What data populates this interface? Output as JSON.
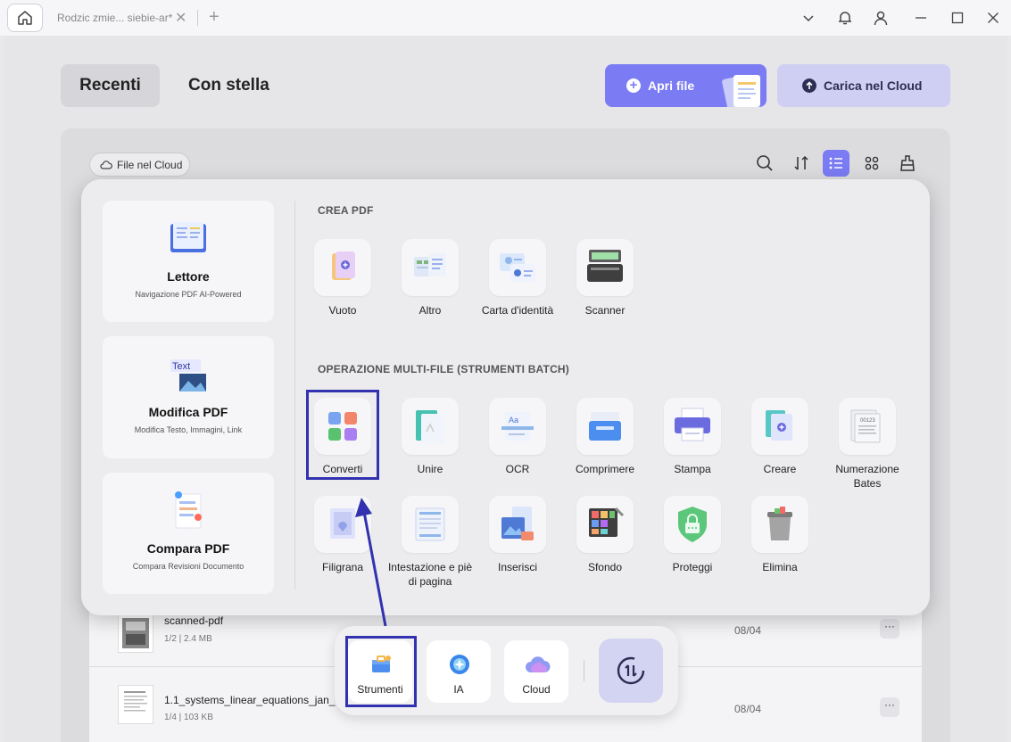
{
  "titlebar": {
    "tab_title": "Rodzic zmie... siebie-ar*",
    "tab_close": "✕",
    "tab_new": "+"
  },
  "nav": {
    "recenti": "Recenti",
    "con_stella": "Con stella"
  },
  "actions": {
    "apri_file": "Apri file",
    "carica_cloud": "Carica nel Cloud"
  },
  "toolbar": {
    "cloud_chip": "File nel Cloud"
  },
  "sidebar": {
    "cards": [
      {
        "title": "Lettore",
        "subtitle": "Navigazione PDF AI-Powered"
      },
      {
        "title": "Modifica PDF",
        "subtitle": "Modifica Testo, Immagini, Link",
        "icon_text": "Text"
      },
      {
        "title": "Compara PDF",
        "subtitle": "Compara Revisioni Documento"
      }
    ]
  },
  "crea_pdf": {
    "title": "CREA PDF",
    "tools": [
      "Vuoto",
      "Altro",
      "Carta d'identità",
      "Scanner"
    ]
  },
  "batch": {
    "title": "OPERAZIONE MULTI-FILE (STRUMENTI BATCH)",
    "tools": [
      "Converti",
      "Unire",
      "OCR",
      "Comprimere",
      "Stampa",
      "Creare",
      "Numerazione Bates",
      "Filigrana",
      "Intestazione e piè di pagina",
      "Inserisci",
      "Sfondo",
      "Proteggi",
      "Elimina"
    ]
  },
  "files": [
    {
      "name": "scanned-pdf",
      "meta": "1/2 | 2.4 MB",
      "date": "08/04",
      "more": "···"
    },
    {
      "name": "1.1_systems_linear_equations_jan_6_2",
      "meta": "1/4 | 103 KB",
      "date": "08/04",
      "more": "···"
    }
  ],
  "dock": {
    "strumenti": "Strumenti",
    "ia": "IA",
    "cloud": "Cloud"
  },
  "colors": {
    "accent": "#7b7cf4",
    "highlight": "#3232b0"
  }
}
